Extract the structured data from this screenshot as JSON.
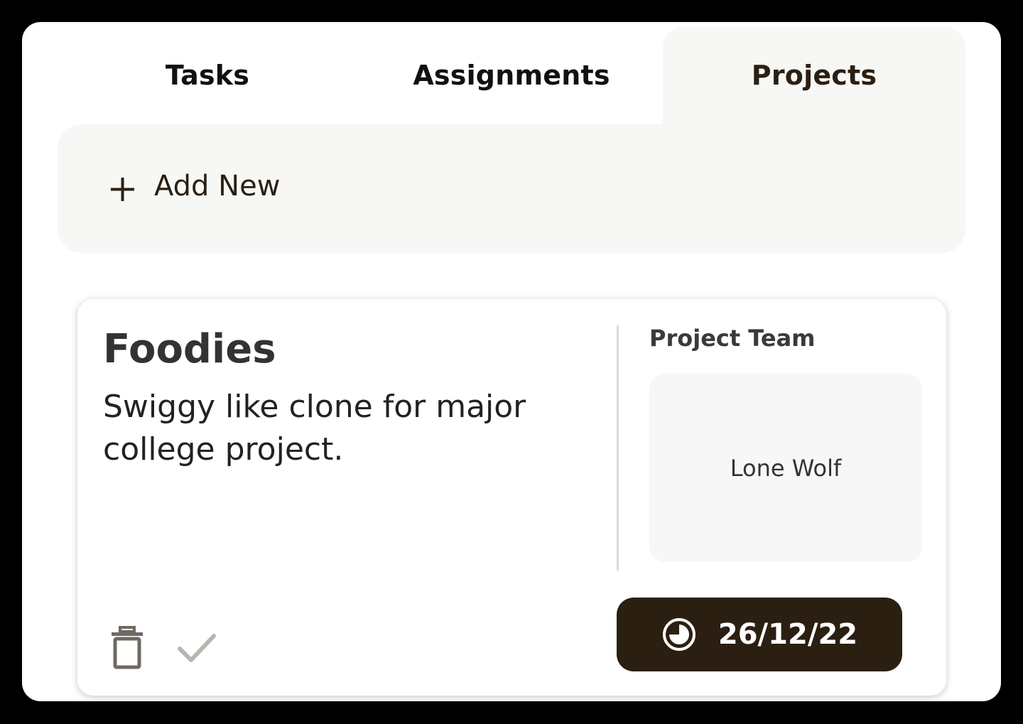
{
  "tabs": [
    {
      "label": "Tasks"
    },
    {
      "label": "Assignments"
    },
    {
      "label": "Projects"
    }
  ],
  "active_tab": "Projects",
  "add_new": {
    "label": "Add New",
    "icon": "plus-icon"
  },
  "project": {
    "title": "Foodies",
    "description": "Swiggy like clone for major college project.",
    "team_heading": "Project Team",
    "team_members": [
      "Lone Wolf"
    ],
    "due_date": "26/12/22",
    "actions": {
      "delete_icon": "trash-icon",
      "complete_icon": "check-icon",
      "due_icon": "clock-icon"
    }
  },
  "colors": {
    "background": "#000000",
    "panel": "#ffffff",
    "tab_active_bg": "#f7f7f5",
    "accent_dark": "#2b1f12",
    "text_dark": "#333333"
  }
}
